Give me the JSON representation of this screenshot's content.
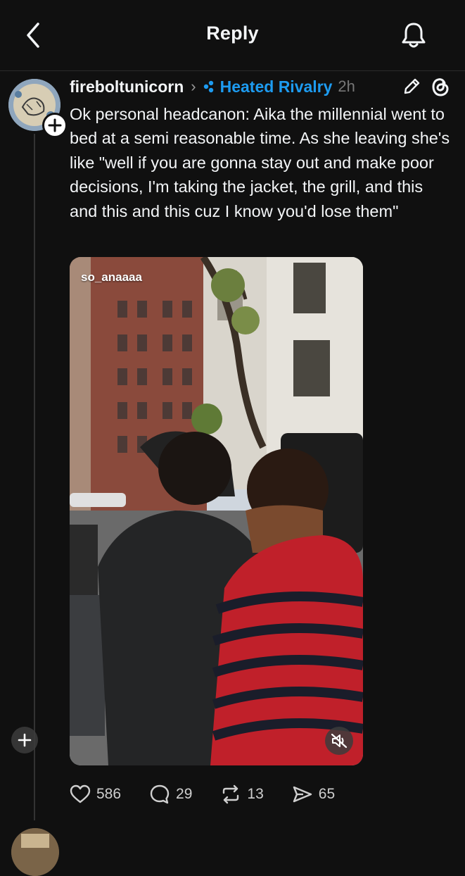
{
  "header": {
    "title": "Reply"
  },
  "post": {
    "username": "fireboltunicorn",
    "community": "Heated Rivalry",
    "timestamp": "2h",
    "text": "Ok personal headcanon: Aika the millennial went to bed at a semi reasonable time. As she leaving she's like \"well if you are gonna stay out and make poor decisions, I'm taking the jacket, the grill, and this and this and this cuz I know you'd lose them\"",
    "media": {
      "handle": "so_anaaaa",
      "muted": true
    },
    "stats": {
      "likes": "586",
      "replies": "29",
      "reposts": "13",
      "shares": "65"
    }
  },
  "colors": {
    "background": "#101010",
    "text": "#f3f5f7",
    "accent": "#1d9bf0",
    "muted": "#777777"
  },
  "icons": {
    "back": "chevron-left-icon",
    "bell": "bell-icon",
    "edit": "pencil-icon",
    "threads": "threads-logo-icon",
    "community": "community-dots-icon",
    "like": "heart-icon",
    "reply": "comment-icon",
    "repost": "repost-icon",
    "share": "send-icon"
  }
}
